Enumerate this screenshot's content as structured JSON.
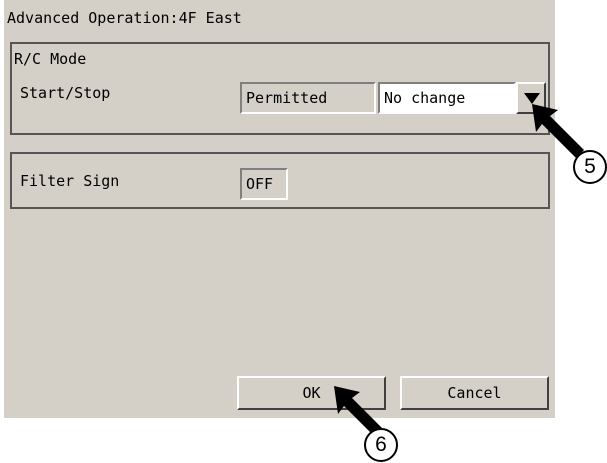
{
  "window": {
    "title": "Advanced Operation:4F East"
  },
  "rc_mode": {
    "group_label": "R/C Mode",
    "start_stop_label": "Start/Stop",
    "status_value": "Permitted",
    "combo_value": "No change"
  },
  "filter": {
    "label": "Filter Sign",
    "value": "OFF"
  },
  "buttons": {
    "ok_label": "OK",
    "cancel_label": "Cancel"
  },
  "callouts": {
    "dropdown_marker": "5",
    "ok_marker": "6"
  },
  "icons": {
    "dropdown": "triangle-down-icon",
    "pointer": "arrow-pointer-icon"
  },
  "colors": {
    "panel_bg": "#d4d0c8",
    "combo_bg": "#ffffff",
    "arrow": "#000000"
  }
}
